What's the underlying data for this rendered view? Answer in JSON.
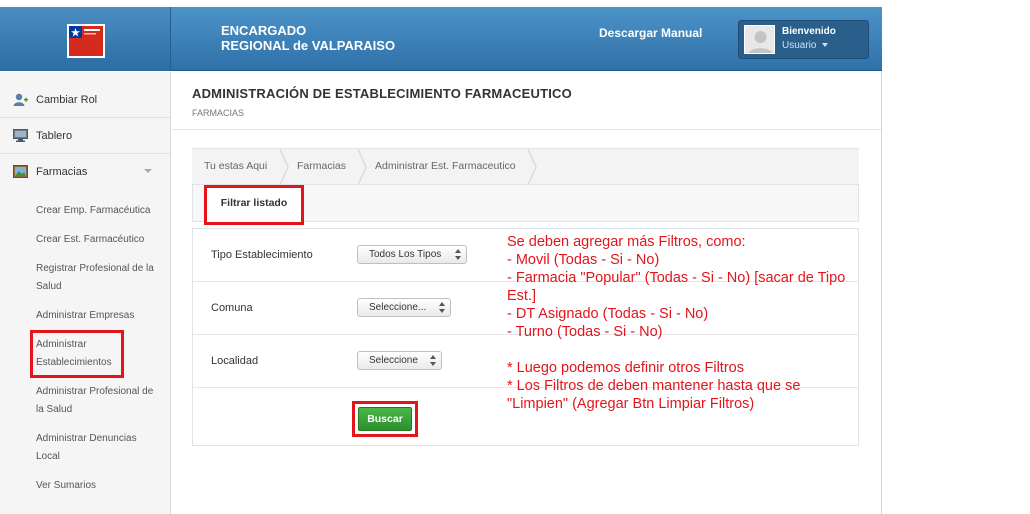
{
  "header": {
    "title_line1": "ENCARGADO",
    "title_line2": "REGIONAL de VALPARAISO",
    "manual_link": "Descargar Manual",
    "user": {
      "welcome": "Bienvenido",
      "role": "Usuario"
    },
    "colors": {
      "topbar": "#3a80b9",
      "logo_red": "#d52b1e",
      "logo_blue": "#0039a6"
    }
  },
  "sidebar": {
    "items": [
      {
        "label": "Cambiar Rol",
        "icon": "user-add-icon"
      },
      {
        "label": "Tablero",
        "icon": "monitor-icon"
      },
      {
        "label": "Farmacias",
        "icon": "picture-icon"
      }
    ],
    "subitems": [
      {
        "label": "Crear Emp. Farmacéutica"
      },
      {
        "label": "Crear Est. Farmacéutico"
      },
      {
        "label": "Registrar Profesional de la Salud"
      },
      {
        "label": "Administrar Empresas"
      },
      {
        "label": "Administrar Establecimientos"
      },
      {
        "label": "Administrar Profesional de la Salud"
      },
      {
        "label": "Administrar Denuncias Local"
      },
      {
        "label": "Ver Sumarios"
      }
    ]
  },
  "main": {
    "title": "ADMINISTRACIÓN DE ESTABLECIMIENTO FARMACEUTICO",
    "subtitle": "FARMACIAS",
    "breadcrumb": [
      "Tu estas Aqui",
      "Farmacias",
      "Administrar Est. Farmaceutico"
    ],
    "filter_tab": "Filtrar listado",
    "filters": [
      {
        "label": "Tipo Establecimiento",
        "value": "Todos Los Tipos"
      },
      {
        "label": "Comuna",
        "value": "Seleccione..."
      },
      {
        "label": "Localidad",
        "value": "Seleccione"
      }
    ],
    "search_button": "Buscar"
  },
  "annotation": {
    "lines": [
      "Se deben agregar más Filtros, como:",
      "- Movil (Todas - Si - No)",
      "- Farmacia \"Popular\" (Todas - Si - No) [sacar de Tipo Est.]",
      "- DT Asignado (Todas - Si - No)",
      "- Turno (Todas - Si - No)",
      "",
      "* Luego podemos definir otros Filtros",
      "* Los Filtros de deben mantener hasta que se \"Limpien\" (Agregar Btn Limpiar Filtros)"
    ],
    "color": "#e3151b"
  }
}
